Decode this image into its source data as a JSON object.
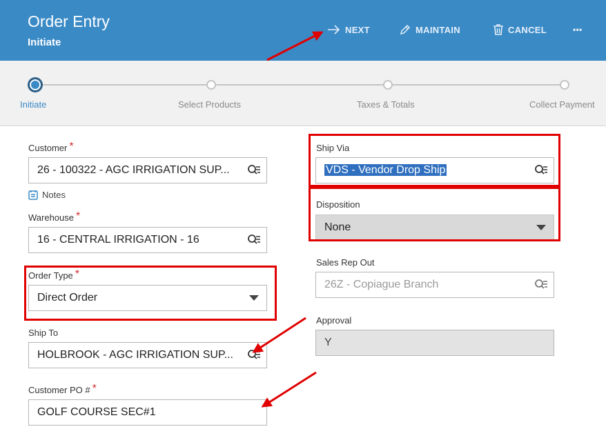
{
  "header": {
    "title": "Order Entry",
    "subtitle": "Initiate",
    "next_label": "NEXT",
    "maintain_label": "MAINTAIN",
    "cancel_label": "CANCEL",
    "more_label": "•••"
  },
  "stepper": {
    "steps": [
      {
        "label": "Initiate",
        "active": true
      },
      {
        "label": "Select Products",
        "active": false
      },
      {
        "label": "Taxes & Totals",
        "active": false
      },
      {
        "label": "Collect Payment",
        "active": false
      }
    ]
  },
  "form": {
    "customer": {
      "label": "Customer",
      "value": "26 - 100322 - AGC IRRIGATION SUP..."
    },
    "notes_label": "Notes",
    "warehouse": {
      "label": "Warehouse",
      "value": "16 - CENTRAL IRRIGATION - 16"
    },
    "order_type": {
      "label": "Order Type",
      "value": "Direct Order"
    },
    "ship_to": {
      "label": "Ship To",
      "value": "HOLBROOK - AGC IRRIGATION SUP..."
    },
    "customer_po": {
      "label": "Customer PO #",
      "value": "GOLF COURSE SEC#1"
    },
    "ship_via": {
      "label": "Ship Via",
      "value": "VDS - Vendor Drop Ship"
    },
    "disposition": {
      "label": "Disposition",
      "value": "None"
    },
    "sales_rep_out": {
      "label": "Sales Rep Out",
      "value": "26Z - Copiague Branch"
    },
    "approval": {
      "label": "Approval",
      "value": "Y"
    }
  },
  "colors": {
    "header": "#3a8ac6",
    "annotation_red": "#e00000",
    "required": "#d32f2f"
  }
}
